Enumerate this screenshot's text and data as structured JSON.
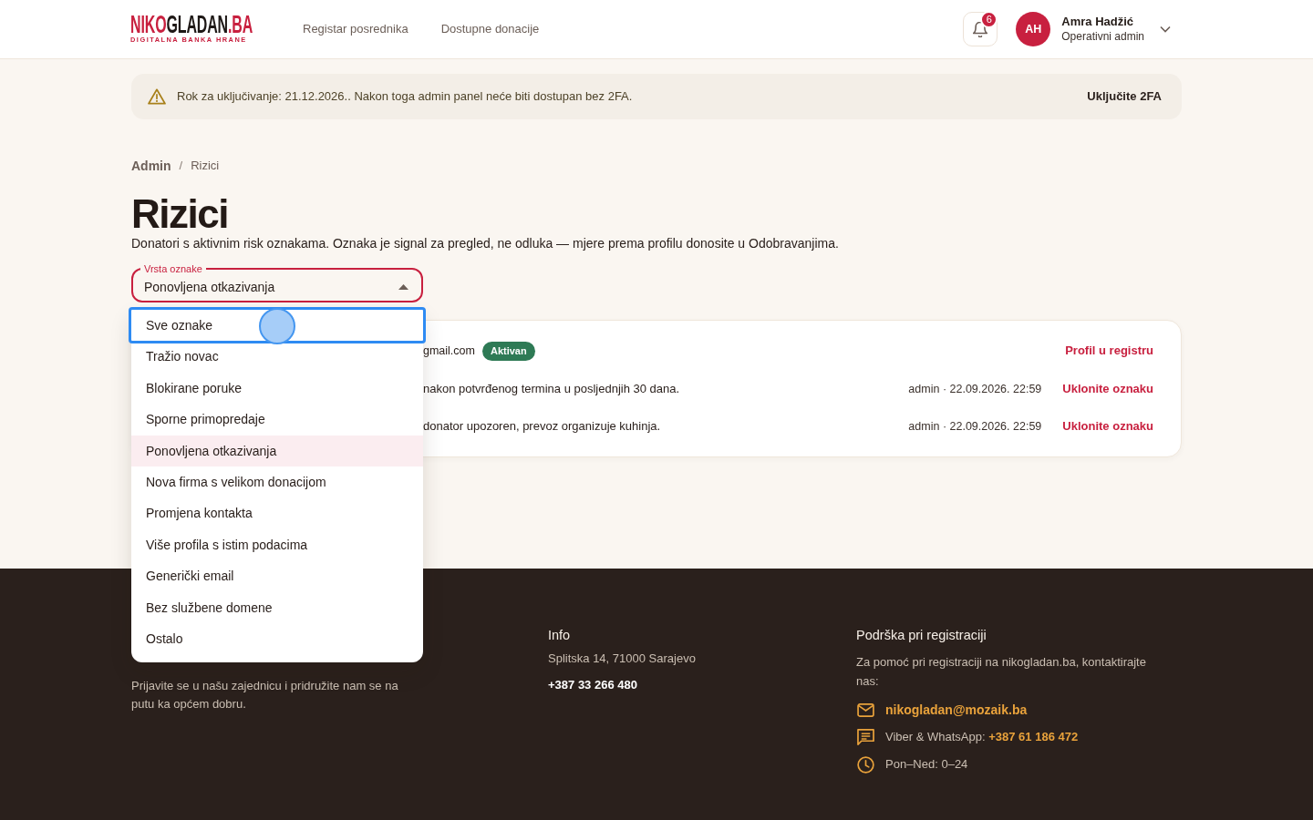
{
  "header": {
    "logo": {
      "parts": [
        {
          "text": "NIKO",
          "color": "#c8203f"
        },
        {
          "text": "GLADAN",
          "color": "#1e1816"
        },
        {
          "text": ".BA",
          "color": "#c8203f"
        }
      ],
      "tagline": "DIGITALNA BANKA HRANE"
    },
    "nav": [
      {
        "label": "Registar posrednika"
      },
      {
        "label": "Dostupne donacije"
      }
    ],
    "notifications": {
      "count": "6"
    },
    "user": {
      "initials": "AH",
      "name": "Amra Hadžić",
      "role": "Operativni admin"
    }
  },
  "alert": {
    "message": "Rok za uključivanje: 21.12.2026.. Nakon toga admin panel neće biti dostupan bez 2FA.",
    "action": "Uključite 2FA"
  },
  "breadcrumb": {
    "items": [
      "Admin",
      "Rizici"
    ],
    "separator": "/"
  },
  "page": {
    "title": "Rizici",
    "description": "Donatori s aktivnim risk oznakama. Oznaka je signal za pregled, ne odluka — mjere prema profilu donosite u Odobravanjima."
  },
  "filter": {
    "label": "Vrsta oznake",
    "value": "Ponovljena otkazivanja",
    "expanded": true,
    "options": [
      {
        "label": "Sve oznake",
        "selected": false,
        "focused": true
      },
      {
        "label": "Tražio novac",
        "selected": false,
        "focused": false
      },
      {
        "label": "Blokirane poruke",
        "selected": false,
        "focused": false
      },
      {
        "label": "Sporne primopredaje",
        "selected": false,
        "focused": false
      },
      {
        "label": "Ponovljena otkazivanja",
        "selected": true,
        "focused": false
      },
      {
        "label": "Nova firma s velikom donacijom",
        "selected": false,
        "focused": false
      },
      {
        "label": "Promjena kontakta",
        "selected": false,
        "focused": false
      },
      {
        "label": "Više profila s istim podacima",
        "selected": false,
        "focused": false
      },
      {
        "label": "Generički email",
        "selected": false,
        "focused": false
      },
      {
        "label": "Bez službene domene",
        "selected": false,
        "focused": false
      },
      {
        "label": "Ostalo",
        "selected": false,
        "focused": false
      }
    ]
  },
  "donor_card": {
    "email": "gmail.com",
    "status": "Aktivan",
    "profile_link": "Profil u registru",
    "flags": [
      {
        "note": "nakon potvrđenog termina u posljednjih 30 dana.",
        "meta": "admin · 22.09.2026. 22:59",
        "action": "Uklonite oznaku"
      },
      {
        "note": "donator upozoren, prevoz organizuje kuhinja.",
        "meta": "admin · 22.09.2026. 22:59",
        "action": "Uklonite oznaku"
      }
    ]
  },
  "footer": {
    "about": "Prijavite se u našu zajednicu i pridružite nam se na putu ka općem dobru.",
    "info": {
      "title": "Info",
      "address": "Splitska 14, 71000 Sarajevo",
      "phone": "+387 33 266 480"
    },
    "support": {
      "title": "Podrška pri registraciji",
      "text": "Za pomoć pri registraciji na nikogladan.ba, kontaktirajte nas:",
      "contacts": [
        {
          "kind": "email",
          "link": "nikogladan@mozaik.ba"
        },
        {
          "kind": "chat",
          "label": "Viber & WhatsApp:",
          "link": "+387 61 186 472"
        },
        {
          "kind": "hours",
          "label": "Pon–Ned: 0–24"
        }
      ]
    }
  }
}
